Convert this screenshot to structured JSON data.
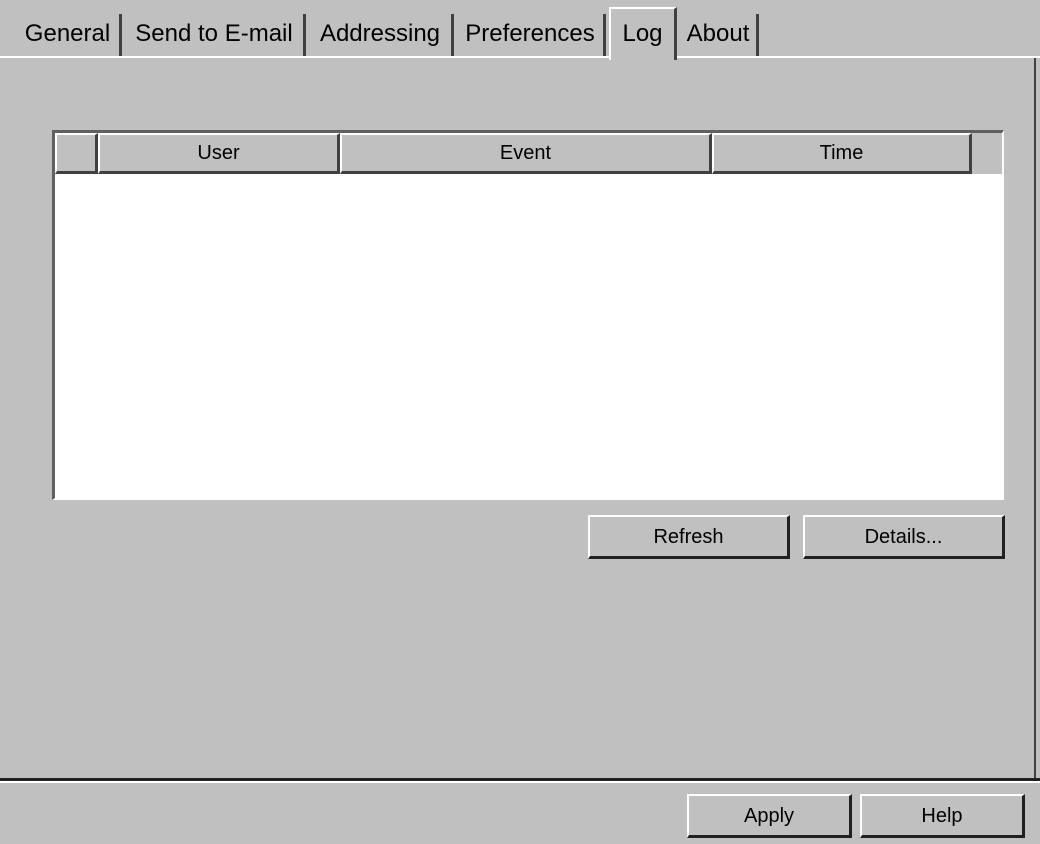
{
  "tabs": [
    {
      "label": "General"
    },
    {
      "label": "Send to E-mail"
    },
    {
      "label": "Addressing"
    },
    {
      "label": "Preferences"
    },
    {
      "label": "Log"
    },
    {
      "label": "About"
    }
  ],
  "selected_tab": "Log",
  "log_table": {
    "columns": [
      "",
      "User",
      "Event",
      "Time"
    ],
    "rows": []
  },
  "buttons": {
    "refresh": "Refresh",
    "details": "Details...",
    "apply": "Apply",
    "help": "Help"
  }
}
